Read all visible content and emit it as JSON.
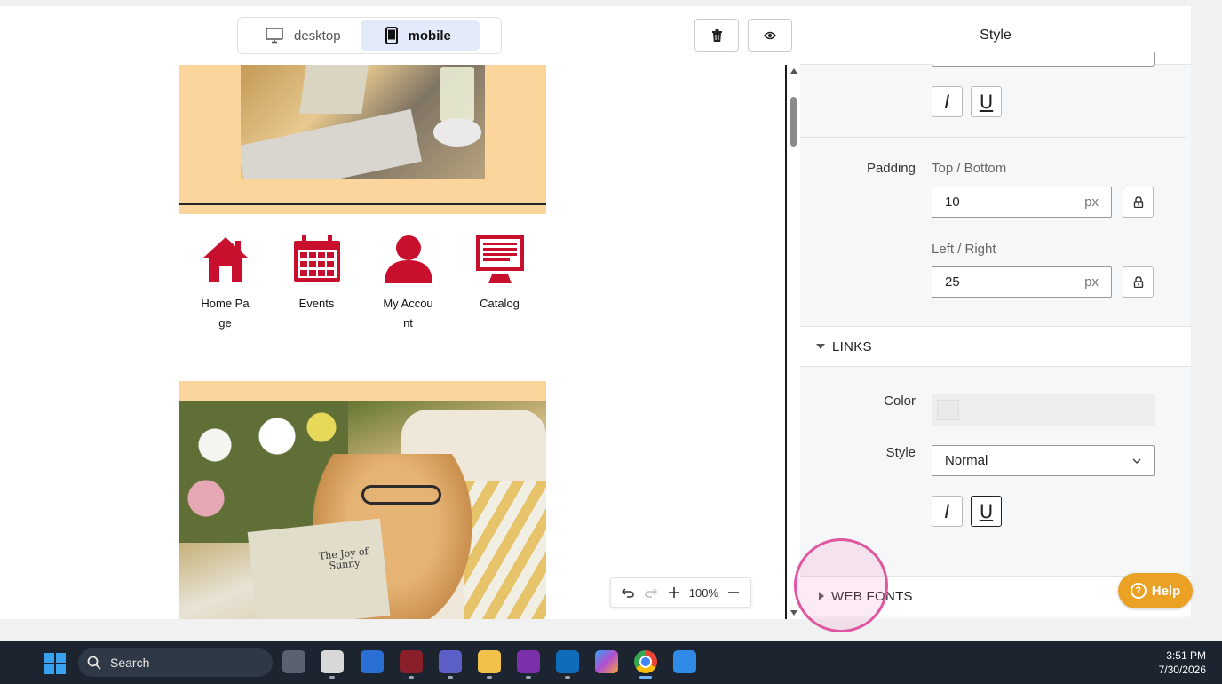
{
  "toolbar": {
    "desktop_label": "desktop",
    "mobile_label": "mobile"
  },
  "email": {
    "nav_icons": [
      {
        "label": "Home Page",
        "icon": "home-icon"
      },
      {
        "label": "Events",
        "icon": "calendar-icon"
      },
      {
        "label": "My Account",
        "icon": "user-icon"
      },
      {
        "label": "Catalog",
        "icon": "catalog-icon"
      }
    ],
    "book_title_text": "The Joy of Sunny"
  },
  "zoom": {
    "level": "100%"
  },
  "panel": {
    "title": "Style",
    "padding_label": "Padding",
    "top_bottom_label": "Top / Bottom",
    "top_bottom_value": "10",
    "left_right_label": "Left / Right",
    "left_right_value": "25",
    "unit": "px",
    "links_section": "LINKS",
    "color_label": "Color",
    "style_label": "Style",
    "style_value": "Normal",
    "web_fonts_section": "WEB FONTS",
    "italic_glyph": "I",
    "underline_glyph": "U"
  },
  "help": {
    "label": "Help"
  },
  "taskbar": {
    "search_label": "Search",
    "time": "3:51 PM",
    "date": "7/30/2026",
    "apps": [
      "file-explorer",
      "snipping-tool",
      "outlook-calendar",
      "teams",
      "folder",
      "onenote",
      "outlook",
      "m365",
      "chrome",
      "photos"
    ]
  },
  "colors": {
    "accent": "#e3ebfb",
    "hero_bg": "#fbd59b",
    "icon_red": "#c8102e",
    "help_orange": "#eba124",
    "highlight_pink": "#e0579f"
  }
}
